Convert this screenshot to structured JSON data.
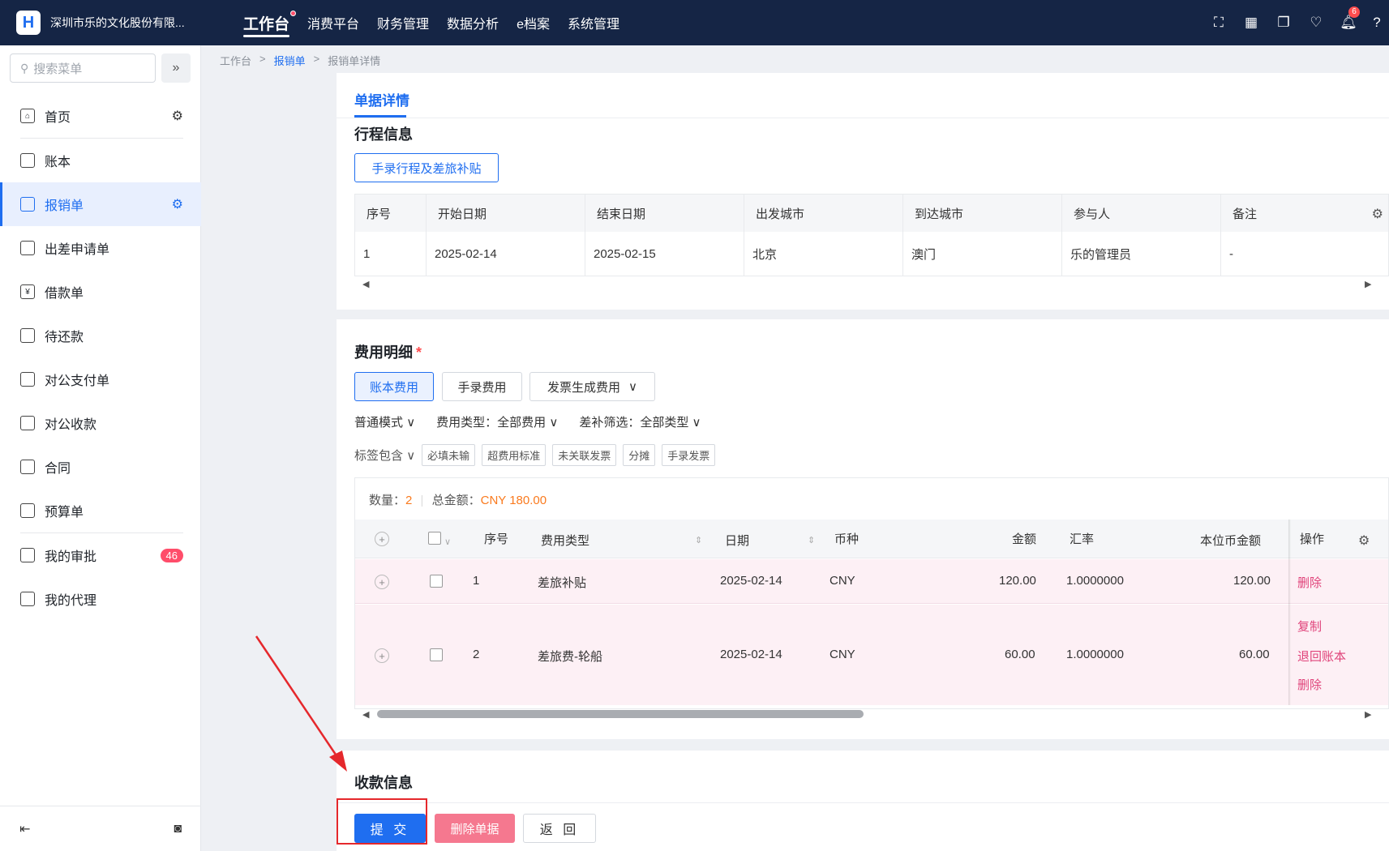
{
  "topbar": {
    "company": "深圳市乐的文化股份有限...",
    "nav": [
      "工作台",
      "消费平台",
      "财务管理",
      "数据分析",
      "e档案",
      "系统管理"
    ],
    "notification_count": "6"
  },
  "sidebar": {
    "search_placeholder": "搜索菜单",
    "items": [
      {
        "label": "首页"
      },
      {
        "label": "账本"
      },
      {
        "label": "报销单"
      },
      {
        "label": "出差申请单"
      },
      {
        "label": "借款单"
      },
      {
        "label": "待还款"
      },
      {
        "label": "对公支付单"
      },
      {
        "label": "对公收款"
      },
      {
        "label": "合同"
      },
      {
        "label": "预算单"
      },
      {
        "label": "我的审批",
        "badge": "46"
      },
      {
        "label": "我的代理"
      }
    ]
  },
  "breadcrumb": [
    "工作台",
    "报销单",
    "报销单详情"
  ],
  "tab": "单据详情",
  "trip": {
    "title": "行程信息",
    "button": "手录行程及差旅补贴",
    "headers": [
      "序号",
      "开始日期",
      "结束日期",
      "出发城市",
      "到达城市",
      "参与人",
      "备注"
    ],
    "rows": [
      [
        "1",
        "2025-02-14",
        "2025-02-15",
        "北京",
        "澳门",
        "乐的管理员",
        "-"
      ]
    ]
  },
  "expense": {
    "title": "费用明细",
    "required_mark": "*",
    "buttons": [
      "账本费用",
      "手录费用",
      "发票生成费用"
    ],
    "filters": [
      "普通模式",
      "费用类型：全部费用",
      "差补筛选：全部类型"
    ],
    "tag_label": "标签包含",
    "tags": [
      "必填未输",
      "超费用标准",
      "未关联发票",
      "分摊",
      "手录发票"
    ],
    "count_label": "数量：",
    "count": "2",
    "total_label": "总金额：",
    "total": "CNY 180.00",
    "headers": [
      "序号",
      "费用类型",
      "日期",
      "币种",
      "金额",
      "汇率",
      "本位币金额",
      "操作"
    ],
    "rows": [
      {
        "no": "1",
        "type": "差旅补贴",
        "date": "2025-02-14",
        "currency": "CNY",
        "amount": "120.00",
        "rate": "1.0000000",
        "local": "120.00",
        "ops": [
          "删除"
        ]
      },
      {
        "no": "2",
        "type": "差旅费-轮船",
        "date": "2025-02-14",
        "currency": "CNY",
        "amount": "60.00",
        "rate": "1.0000000",
        "local": "60.00",
        "ops": [
          "复制",
          "退回账本",
          "删除"
        ]
      }
    ]
  },
  "payee": {
    "title": "收款信息"
  },
  "actions": {
    "submit": "提 交",
    "delete": "删除单据",
    "back": "返 回"
  }
}
